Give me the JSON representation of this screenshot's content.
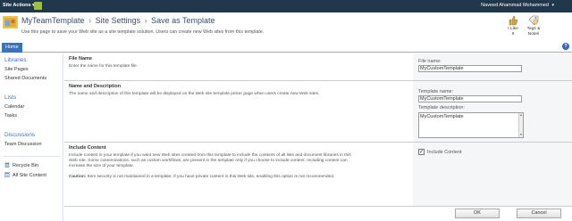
{
  "topbar": {
    "site_actions": "Site Actions",
    "user_name": "Naveed Ahammad Mohammed"
  },
  "header": {
    "breadcrumb": [
      "MyTeamTemplate",
      "Site Settings",
      "Save as Template"
    ],
    "separator": "›",
    "description": "Use this page to save your Web site as a site template solution. Users can create new Web sites from this template.",
    "ribbon_buttons": [
      {
        "label_line1": "I Like",
        "label_line2": "It",
        "icon": "thumbs-up-icon"
      },
      {
        "label_line1": "Tags &",
        "label_line2": "Notes",
        "icon": "tag-icon"
      }
    ]
  },
  "tabs": {
    "home": "Home"
  },
  "leftnav": {
    "libraries_heading": "Libraries",
    "libraries": [
      "Site Pages",
      "Shared Documents"
    ],
    "lists_heading": "Lists",
    "lists": [
      "Calendar",
      "Tasks"
    ],
    "discussions_heading": "Discussions",
    "discussions": [
      "Team Discussion"
    ],
    "recycle_bin": "Recycle Bin",
    "all_site_content": "All Site Content"
  },
  "sections": {
    "file_name": {
      "title": "File Name",
      "description": "Enter the name for this template file.",
      "field_label": "File name:",
      "field_value": "MyCustomTemplate"
    },
    "name_desc": {
      "title": "Name and Description",
      "description": "The name and description of this template will be displayed on the Web site template picker page when users create new Web sites.",
      "name_label": "Template name:",
      "name_value": "MyCustomTemplate",
      "desc_label": "Template description:",
      "desc_value": "MyCustomTemplate"
    },
    "include_content": {
      "title": "Include Content",
      "description": "Include content in your template if you want new Web sites created from this template to include the contents of all lists and document libraries in this Web site. Some customizations, such as custom workflows, are present in the template only if you choose to include content. Including content can increase the size of your template.",
      "caution_label": "Caution:",
      "caution_text": "Item security is not maintained in a template. If you have private content in this Web site, enabling this option is not recommended.",
      "checkbox_label": "Include Content",
      "checked": true
    }
  },
  "buttons": {
    "ok": "OK",
    "cancel": "Cancel"
  },
  "colors": {
    "topbar": "#21374c",
    "accent": "#3b73b9"
  }
}
